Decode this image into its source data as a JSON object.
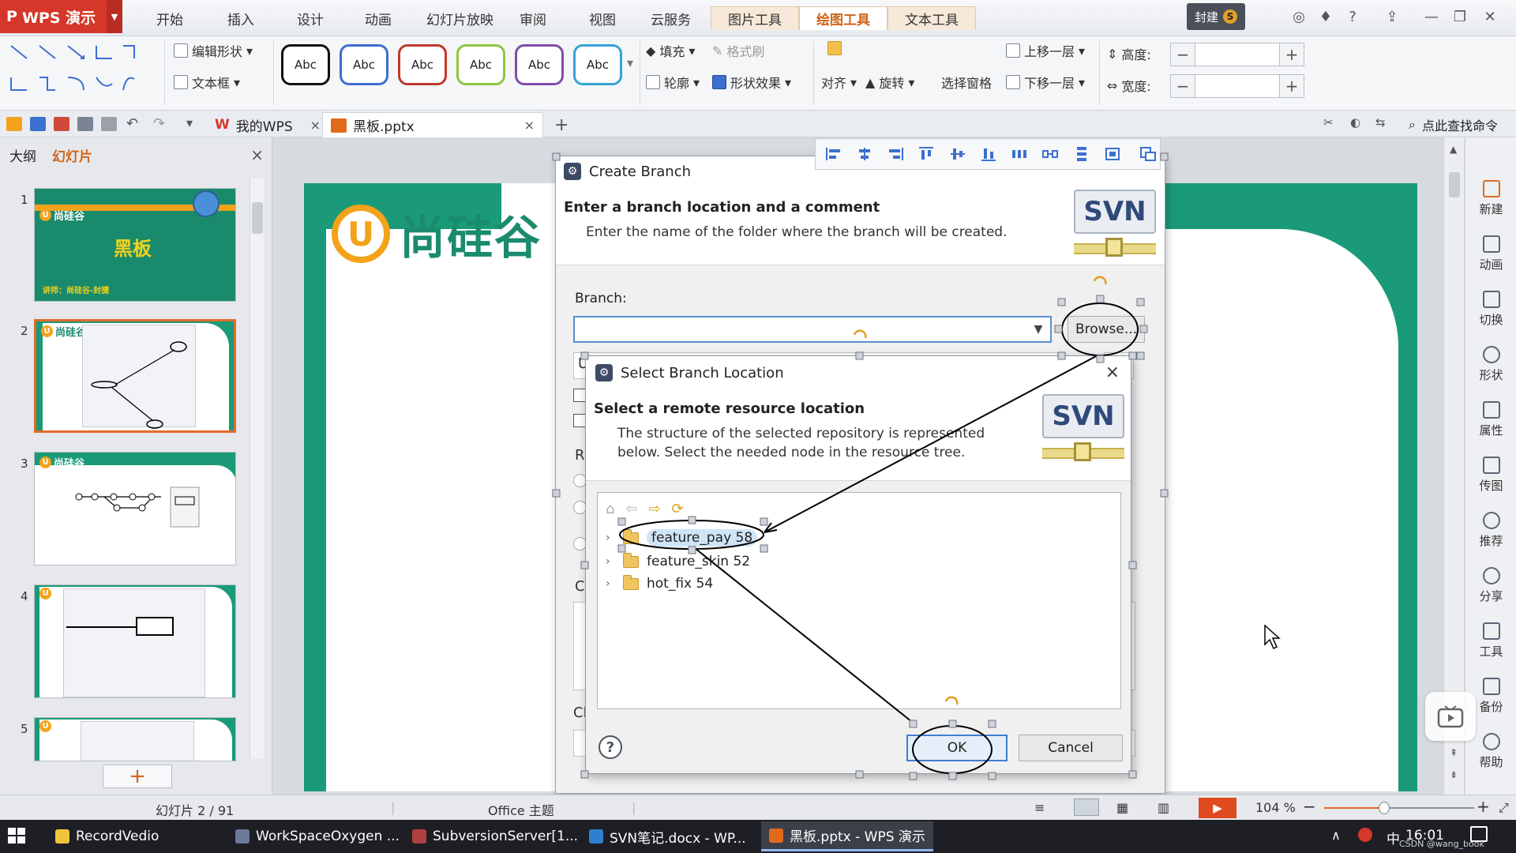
{
  "app": {
    "name": "WPS 演示",
    "user_chip": "封建"
  },
  "menu": {
    "tabs": [
      "开始",
      "插入",
      "设计",
      "动画",
      "幻灯片放映",
      "审阅",
      "视图",
      "云服务",
      "图片工具",
      "绘图工具",
      "文本工具"
    ],
    "active": "绘图工具"
  },
  "ribbon": {
    "edit_shape": "编辑形状",
    "text_box": "文本框",
    "abc_label": "Abc",
    "fill": "填充",
    "format_painter": "格式刷",
    "outline": "轮廓",
    "shape_effect": "形状效果",
    "align": "对齐",
    "rotate": "旋转",
    "selection_pane": "选择窗格",
    "bring_forward": "上移一层",
    "send_backward": "下移一层",
    "height": "高度:",
    "width": "宽度:",
    "minus": "−",
    "plus": "+",
    "abc_colors": [
      "#111111",
      "#3b6fd0",
      "#c0392b",
      "#8dc63f",
      "#7d4ea8",
      "#35a3d6"
    ]
  },
  "docbar": {
    "home_tab": "我的WPS",
    "file_tab": "黑板.pptx",
    "find_command": "点此查找命令",
    "new_tab": "+",
    "close": "×"
  },
  "left_panel": {
    "tab_outline": "大纲",
    "tab_slides": "幻灯片",
    "close": "×",
    "thumb_numbers": [
      "1",
      "2",
      "3",
      "4",
      "5"
    ],
    "logo_text": "尚硅谷",
    "slide1_title": "黑板",
    "slide1_footer": "讲师：尚硅谷-封捷",
    "add_slide": "+"
  },
  "slide": {
    "logo_letter": "U",
    "logo_text": "尚硅谷"
  },
  "create_branch": {
    "title": "Create Branch",
    "heading": "Enter a branch location and a comment",
    "description": "Enter the name of the folder where the branch will be created.",
    "svn_logo": "SVN",
    "branch_label": "Branch:",
    "branch_value": "",
    "browse": "Browse...",
    "fragments": [
      "U",
      "R",
      "C",
      "Cl"
    ]
  },
  "select_branch": {
    "title": "Select Branch Location",
    "close": "×",
    "heading": "Select a remote resource location",
    "description_line1": "The structure of the selected repository is represented",
    "description_line2": "below. Select the needed node in the resource tree.",
    "svn_logo": "SVN",
    "tree": [
      {
        "label": "feature_pay 58",
        "selected": true
      },
      {
        "label": "feature_skin 52",
        "selected": false
      },
      {
        "label": "hot_fix 54",
        "selected": false
      }
    ],
    "help": "?",
    "ok": "OK",
    "cancel": "Cancel"
  },
  "right_panel": {
    "items": [
      "新建",
      "动画",
      "切换",
      "形状",
      "属性",
      "传图",
      "推荐",
      "分享",
      "工具",
      "备份",
      "帮助"
    ]
  },
  "status": {
    "slide_counter": "幻灯片 2 / 91",
    "theme": "Office 主题",
    "zoom": "104 %",
    "zoom_fraction": 0.4
  },
  "taskbar": {
    "items": [
      {
        "label": "RecordVedio",
        "color": "#f0c33c"
      },
      {
        "label": "WorkSpaceOxygen ...",
        "color": "#6c7a99"
      },
      {
        "label": "SubversionServer[1...",
        "color": "#b04040"
      },
      {
        "label": "SVN笔记.docx - WP...",
        "color": "#2f7fd0"
      },
      {
        "label": "黑板.pptx - WPS 演示",
        "color": "#e06a1c"
      }
    ],
    "ime": "中",
    "clock": "16:01",
    "watermark": "CSDN @wang_book"
  }
}
